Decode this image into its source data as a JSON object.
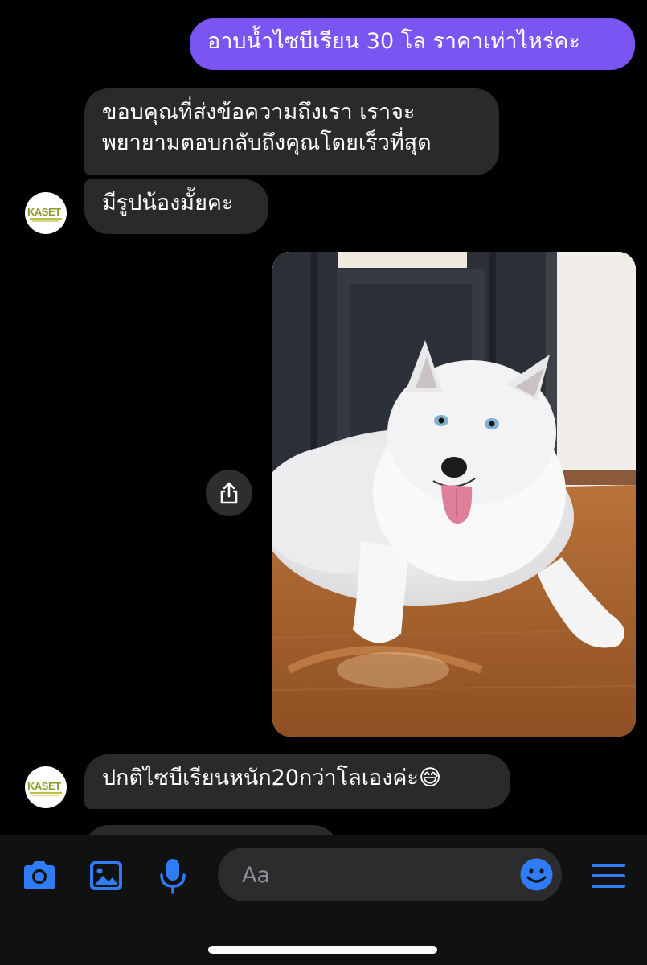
{
  "conversation": {
    "messages": [
      {
        "sender": "me",
        "text": "อาบน้ำไซบีเรียน 30 โล ราคาเท่าไหร่คะ"
      },
      {
        "sender": "shop",
        "text": "ขอบคุณที่ส่งข้อความถึงเรา เราจะ\nพยายามตอบกลับถึงคุณโดยเร็วที่สุด"
      },
      {
        "sender": "shop",
        "text": "มีรูปน้องมั้ยคะ"
      },
      {
        "sender": "me",
        "type": "image",
        "content": "white siberian husky lying on wooden floor"
      },
      {
        "sender": "shop",
        "text": "ปกติไซบีเรียนหนัก20กว่าโลเองค่ะ😅"
      }
    ]
  },
  "avatar": {
    "brand": "KASET"
  },
  "composer": {
    "placeholder": "Aa"
  },
  "icons": {
    "camera": "camera-icon",
    "gallery": "image-icon",
    "mic": "microphone-icon",
    "emoji": "emoji-icon",
    "menu": "menu-icon",
    "share": "share-icon"
  },
  "colors": {
    "sent_bubble": "#7b55f1",
    "received_bubble": "#2a2a2c",
    "accent": "#2f7cf6"
  }
}
